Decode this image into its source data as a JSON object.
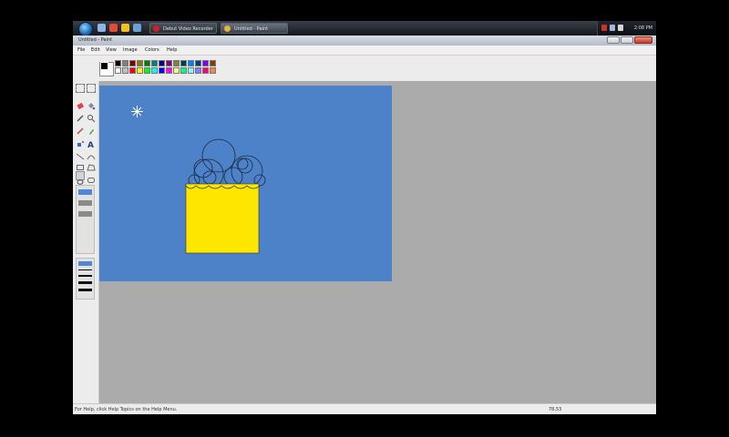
{
  "taskbar": {
    "tasks": [
      {
        "label": "Debut Video Recorder",
        "icon": "record-icon",
        "active": false
      },
      {
        "label": "Untitled - Paint",
        "icon": "paint-icon",
        "active": true
      }
    ],
    "clock": "2:08 PM"
  },
  "window": {
    "title": "Untitled - Paint"
  },
  "menu": [
    "File",
    "Edit",
    "View",
    "Image",
    "Colors",
    "Help"
  ],
  "palette": {
    "foreground": "#000000",
    "background": "#ffffff",
    "colors_row1": [
      "#000000",
      "#808080",
      "#800000",
      "#808000",
      "#008000",
      "#008080",
      "#000080",
      "#800080",
      "#808040",
      "#004040",
      "#0080ff",
      "#004080",
      "#8000ff",
      "#804000"
    ],
    "colors_row2": [
      "#ffffff",
      "#c0c0c0",
      "#ff0000",
      "#ffff00",
      "#00ff00",
      "#00ffff",
      "#0000ff",
      "#ff00ff",
      "#ffff80",
      "#00ff80",
      "#80ffff",
      "#8080ff",
      "#ff0080",
      "#ff8040"
    ]
  },
  "canvas": {
    "background": "#4d81c8",
    "square_fill": "#ffe600"
  },
  "status": {
    "help_text": "For Help, click Help Topics on the Help Menu.",
    "coords": "78,53"
  }
}
